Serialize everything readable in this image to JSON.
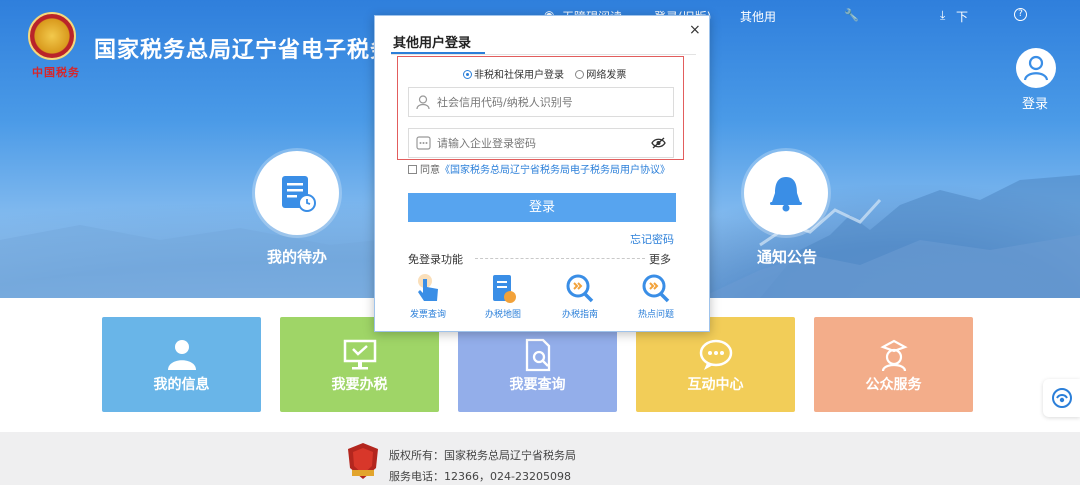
{
  "header": {
    "site_title": "国家税务总局辽宁省电子税务局",
    "emblem_text": "中国税务",
    "topnav": {
      "accessible": "无障碍阅读",
      "old_login": "登录(旧版)",
      "other_users": "其他用",
      "download": "下",
      "help": "?"
    },
    "login_label": "登录"
  },
  "features": [
    {
      "label": "我的待办",
      "icon": "document-clock-icon"
    },
    {
      "label": "通知公告",
      "icon": "bell-icon"
    }
  ],
  "tiles": [
    {
      "label": "我的信息",
      "color": "#69b5e8",
      "icon": "user-icon"
    },
    {
      "label": "我要办税",
      "color": "#9fd567",
      "icon": "monitor-icon"
    },
    {
      "label": "我要查询",
      "color": "#93aeea",
      "icon": "search-document-icon"
    },
    {
      "label": "互动中心",
      "color": "#f2cd58",
      "icon": "chat-icon"
    },
    {
      "label": "公众服务",
      "color": "#f3ad8a",
      "icon": "service-person-icon"
    }
  ],
  "footer": {
    "copyright": "版权所有：国家税务总局辽宁省税务局",
    "phone": "服务电话：12366，024-23205098"
  },
  "modal": {
    "tab": "其他用户登录",
    "close": "×",
    "radio_option_1": "非税和社保用户登录",
    "radio_option_2": "网络发票",
    "id_placeholder": "社会信用代码/纳税人识别号",
    "password_placeholder": "请输入企业登录密码",
    "agree_prefix": "同意",
    "agree_link": "《国家税务总局辽宁省税务局电子税务局用户协议》",
    "login_button": "登录",
    "forgot": "忘记密码",
    "free_label": "免登录功能",
    "more": "更多",
    "quick_links": [
      {
        "label": "发票查询",
        "icon": "hand-pointer-icon"
      },
      {
        "label": "办税地图",
        "icon": "map-document-icon"
      },
      {
        "label": "办税指南",
        "icon": "magnifier-guide-icon"
      },
      {
        "label": "热点问题",
        "icon": "magnifier-hot-icon"
      }
    ]
  }
}
